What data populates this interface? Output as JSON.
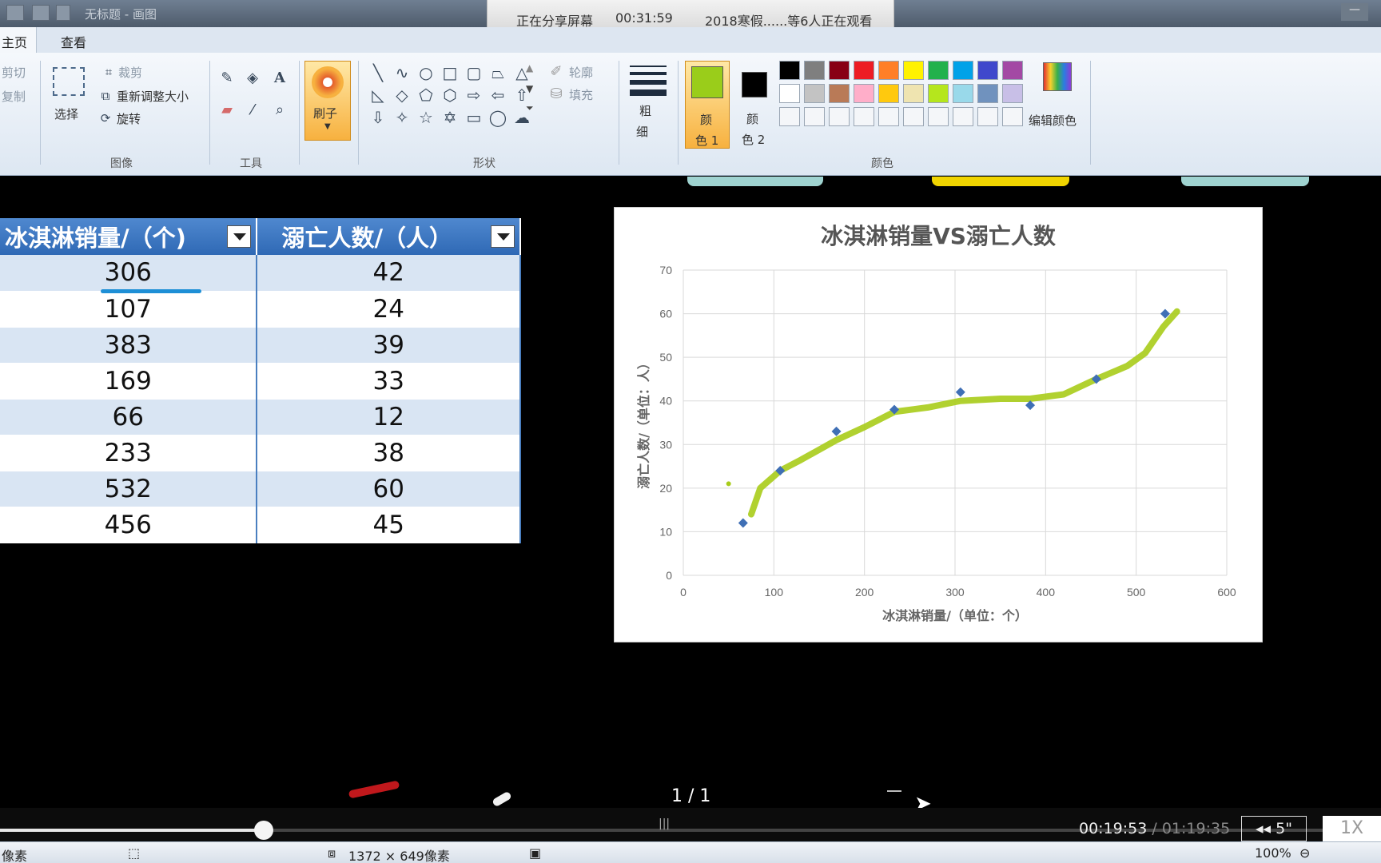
{
  "titlebar": {
    "title": "无标题 - 画图"
  },
  "share_banner": {
    "status": "正在分享屏幕",
    "elapsed": "00:31:59",
    "viewers": "2018寒假......等6人正在观看"
  },
  "ribbon": {
    "tabs": [
      "主页",
      "查看"
    ],
    "clipboard": {
      "cut": "剪切",
      "copy": "复制"
    },
    "image": {
      "select": "选择",
      "crop": "裁剪",
      "resize": "重新调整大小",
      "rotate": "旋转",
      "group": "图像"
    },
    "tools": {
      "group": "工具"
    },
    "brush": {
      "label": "刷子"
    },
    "shapes": {
      "outline": "轮廓",
      "fill": "填充",
      "group": "形状"
    },
    "size": {
      "label1": "粗",
      "label2": "细"
    },
    "colors": {
      "color1_a": "颜",
      "color1_b": "色 1",
      "color2_a": "颜",
      "color2_b": "色 2",
      "edit": "编辑颜色",
      "group": "颜色",
      "color1_value": "#9acd1a",
      "color2_value": "#000000",
      "palette_row1": [
        "#000000",
        "#7f7f7f",
        "#880015",
        "#ed1c24",
        "#ff7f27",
        "#fff200",
        "#22b14c",
        "#00a2e8",
        "#3f48cc",
        "#a349a4"
      ],
      "palette_row2": [
        "#ffffff",
        "#c3c3c3",
        "#b97a57",
        "#ffaec9",
        "#ffc90e",
        "#efe4b0",
        "#b5e61d",
        "#99d9ea",
        "#7092be",
        "#c8bfe7"
      ]
    }
  },
  "table": {
    "headers": [
      "冰淇淋销量/（个)",
      "溺亡人数/（人）"
    ],
    "rows": [
      [
        "306",
        "42"
      ],
      [
        "107",
        "24"
      ],
      [
        "383",
        "39"
      ],
      [
        "169",
        "33"
      ],
      [
        "66",
        "12"
      ],
      [
        "233",
        "38"
      ],
      [
        "532",
        "60"
      ],
      [
        "456",
        "45"
      ]
    ]
  },
  "chart_data": {
    "type": "scatter",
    "title": "冰淇淋销量VS溺亡人数",
    "xlabel": "冰淇淋销量/（单位：个）",
    "ylabel": "溺亡人数/（单位：人）",
    "xlim": [
      0,
      600
    ],
    "ylim": [
      0,
      70
    ],
    "xticks": [
      "0",
      "100",
      "200",
      "300",
      "400",
      "500",
      "600"
    ],
    "yticks": [
      "0",
      "10",
      "20",
      "30",
      "40",
      "50",
      "60",
      "70"
    ],
    "grid": true,
    "series": [
      {
        "x": [
          306,
          107,
          383,
          169,
          66,
          233,
          532,
          456
        ],
        "y": [
          42,
          24,
          39,
          33,
          12,
          38,
          60,
          45
        ]
      }
    ],
    "annotation_curve": {
      "color": "#a8cc1a",
      "x": [
        75,
        85,
        107,
        130,
        169,
        200,
        233,
        270,
        306,
        350,
        383,
        420,
        456,
        490,
        510,
        530,
        545
      ],
      "y": [
        14,
        20,
        24,
        26.5,
        31,
        34,
        37.5,
        38.5,
        40,
        40.5,
        40.5,
        41.5,
        45,
        48,
        51,
        57,
        60.5
      ]
    },
    "series_color": "#3f6fb5"
  },
  "player": {
    "page": "1 / 1",
    "current": "00:19:53",
    "total": " / 01:19:35",
    "progress": 0.25,
    "rewind": "◂◂ 5\"",
    "speed": "1X"
  },
  "statusbar": {
    "left": "像素",
    "dims": "1372 × 649像素",
    "zoom": "100%"
  }
}
